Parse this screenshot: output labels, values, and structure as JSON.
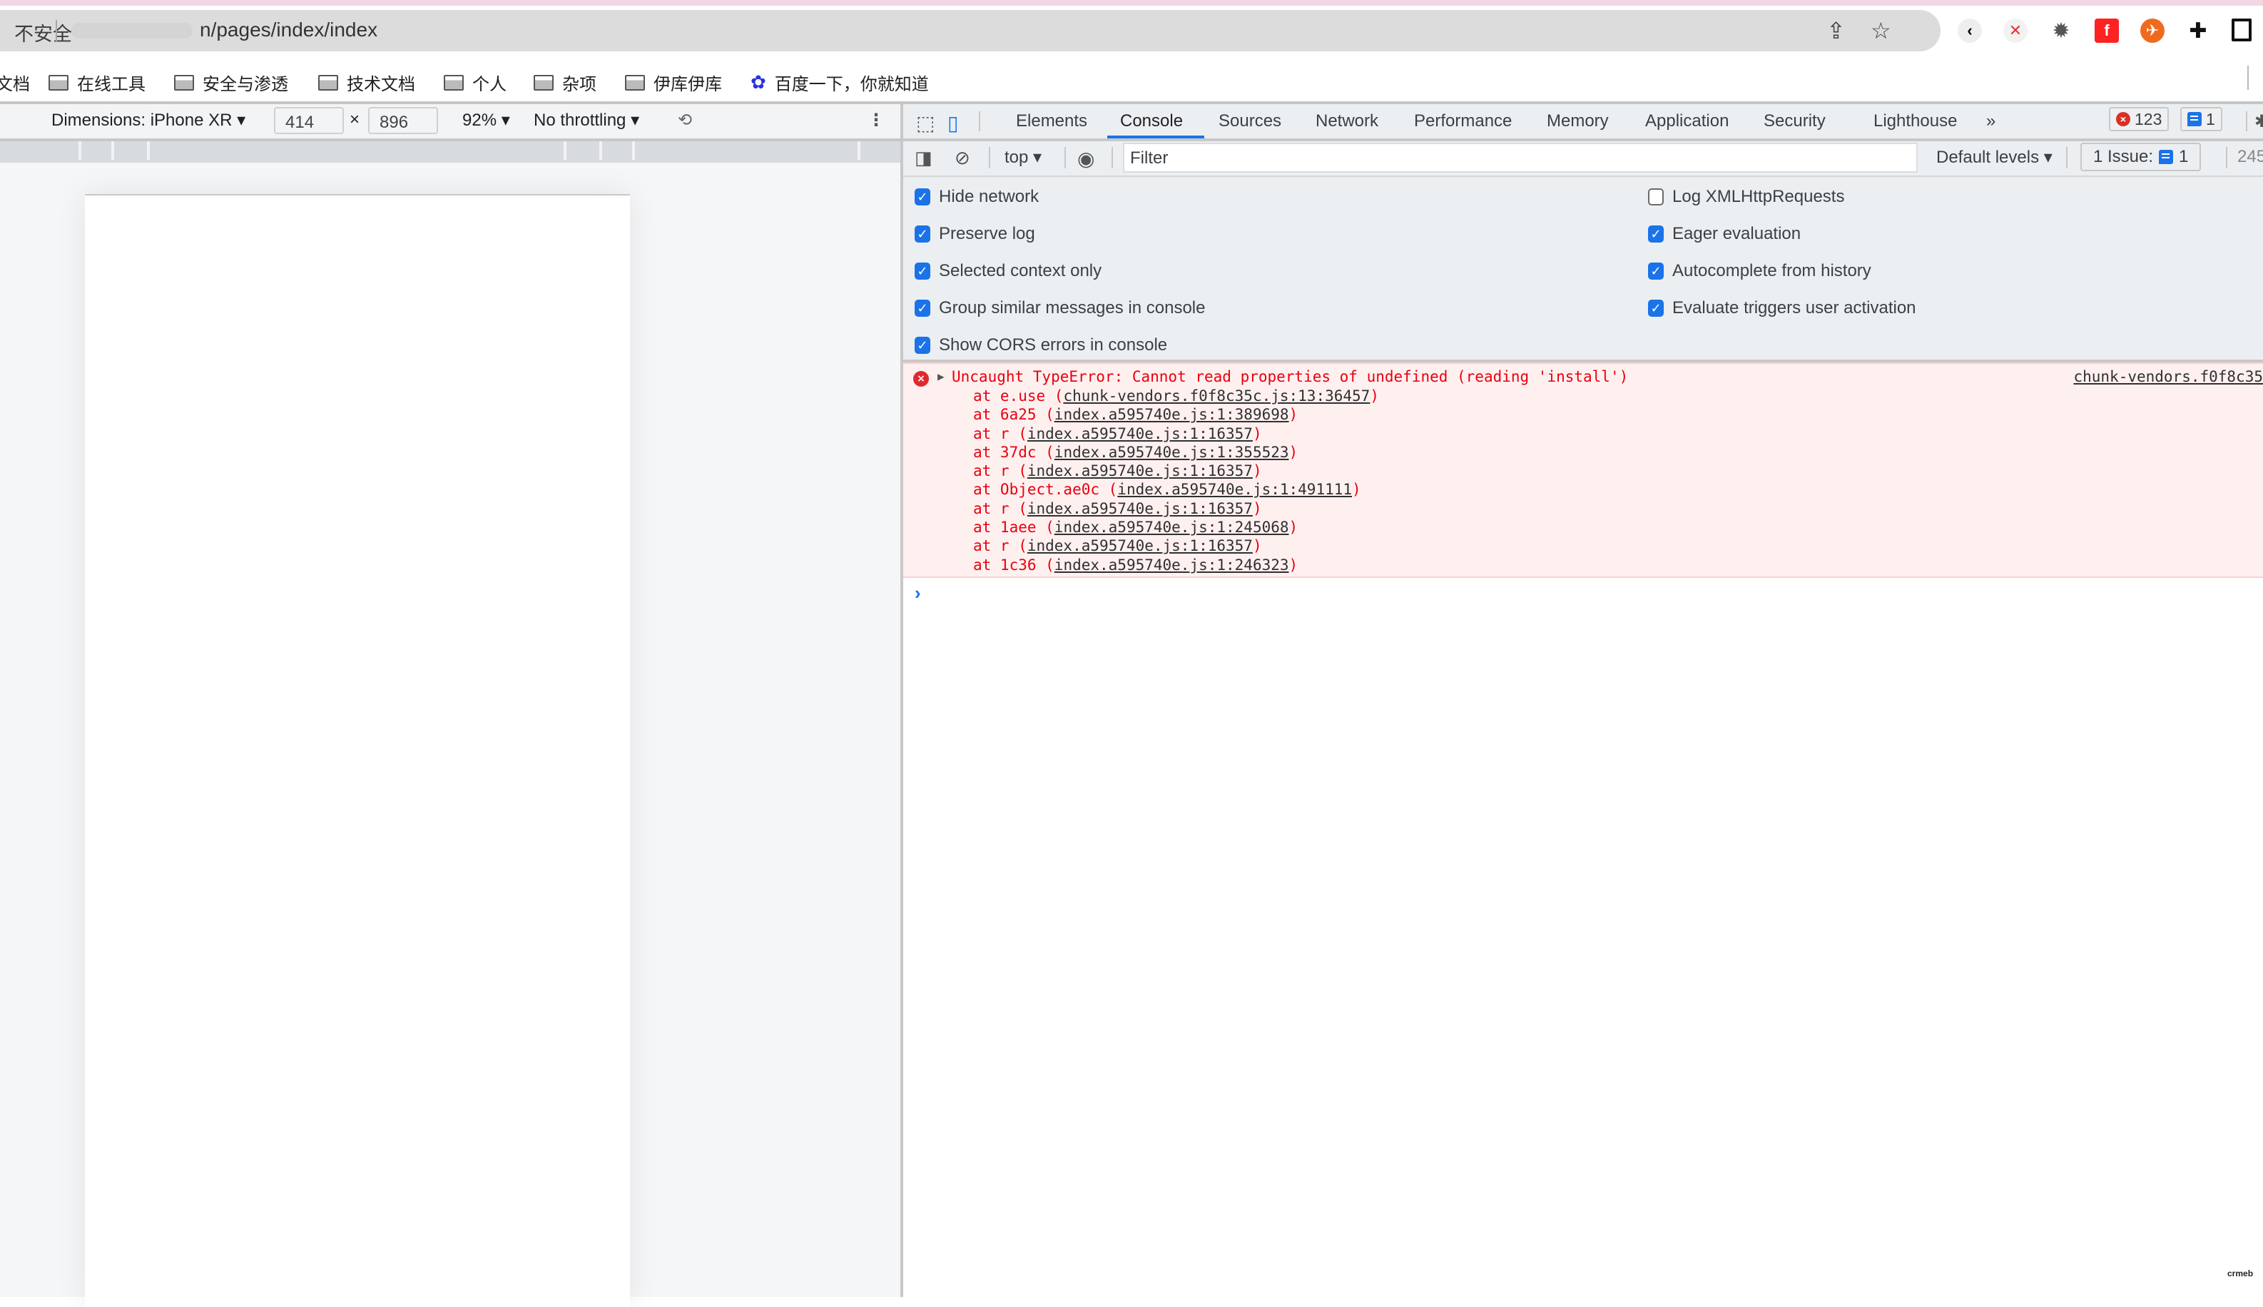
{
  "browser": {
    "security_label": "不安全",
    "url": "n/pages/index/index",
    "toolbar_icons": [
      "share-icon",
      "bookmark-star-icon"
    ],
    "extensions": [
      "back-extension",
      "color-picker-extension",
      "gear-extension",
      "flash-extension",
      "rocket-extension",
      "puzzle-extensions-icon",
      "sidebar-icon"
    ]
  },
  "bookmarks": [
    {
      "label": "文档",
      "icon": "folder-icon"
    },
    {
      "label": "在线工具",
      "icon": "folder-icon"
    },
    {
      "label": "安全与渗透",
      "icon": "folder-icon"
    },
    {
      "label": "技术文档",
      "icon": "folder-icon"
    },
    {
      "label": "个人",
      "icon": "folder-icon"
    },
    {
      "label": "杂项",
      "icon": "folder-icon"
    },
    {
      "label": "伊库伊库",
      "icon": "folder-icon"
    },
    {
      "label": "百度一下，你就知道",
      "icon": "baidu-paw-icon"
    }
  ],
  "device_toolbar": {
    "dimensions_label": "Dimensions: iPhone XR",
    "width": "414",
    "times": "×",
    "height": "896",
    "zoom": "92%",
    "throttling": "No throttling"
  },
  "devtools": {
    "tabs": [
      "Elements",
      "Console",
      "Sources",
      "Network",
      "Performance",
      "Memory",
      "Application",
      "Security",
      "Lighthouse"
    ],
    "active_tab": "Console",
    "more_tabs": "»",
    "error_count": "123",
    "message_count": "1",
    "console_toolbar": {
      "context": "top",
      "filter_placeholder": "Filter",
      "levels": "Default levels",
      "issues_label": "1 Issue:",
      "issues_count": "1",
      "hidden_count": "245"
    },
    "settings_left": [
      {
        "label": "Hide network",
        "checked": true
      },
      {
        "label": "Preserve log",
        "checked": true
      },
      {
        "label": "Selected context only",
        "checked": true
      },
      {
        "label": "Group similar messages in console",
        "checked": true
      },
      {
        "label": "Show CORS errors in console",
        "checked": true
      }
    ],
    "settings_right": [
      {
        "label": "Log XMLHttpRequests",
        "checked": false
      },
      {
        "label": "Eager evaluation",
        "checked": true
      },
      {
        "label": "Autocomplete from history",
        "checked": true
      },
      {
        "label": "Evaluate triggers user activation",
        "checked": true
      }
    ],
    "error": {
      "message": "Uncaught TypeError: Cannot read properties of undefined (reading 'install')",
      "source": "chunk-vendors.f0f8c35",
      "stack": [
        {
          "fn": "at e.use (",
          "link": "chunk-vendors.f0f8c35c.js:13:36457",
          "end": ")"
        },
        {
          "fn": "at 6a25 (",
          "link": "index.a595740e.js:1:389698",
          "end": ")"
        },
        {
          "fn": "at r (",
          "link": "index.a595740e.js:1:16357",
          "end": ")"
        },
        {
          "fn": "at 37dc (",
          "link": "index.a595740e.js:1:355523",
          "end": ")"
        },
        {
          "fn": "at r (",
          "link": "index.a595740e.js:1:16357",
          "end": ")"
        },
        {
          "fn": "at Object.ae0c (",
          "link": "index.a595740e.js:1:491111",
          "end": ")"
        },
        {
          "fn": "at r (",
          "link": "index.a595740e.js:1:16357",
          "end": ")"
        },
        {
          "fn": "at 1aee (",
          "link": "index.a595740e.js:1:245068",
          "end": ")"
        },
        {
          "fn": "at r (",
          "link": "index.a595740e.js:1:16357",
          "end": ")"
        },
        {
          "fn": "at 1c36 (",
          "link": "index.a595740e.js:1:246323",
          "end": ")"
        }
      ]
    },
    "prompt": "›"
  },
  "watermark": "crmeb",
  "colors": {
    "accent": "#1a73e8",
    "error_text": "#e8000d",
    "error_bg": "#fff0f0"
  }
}
